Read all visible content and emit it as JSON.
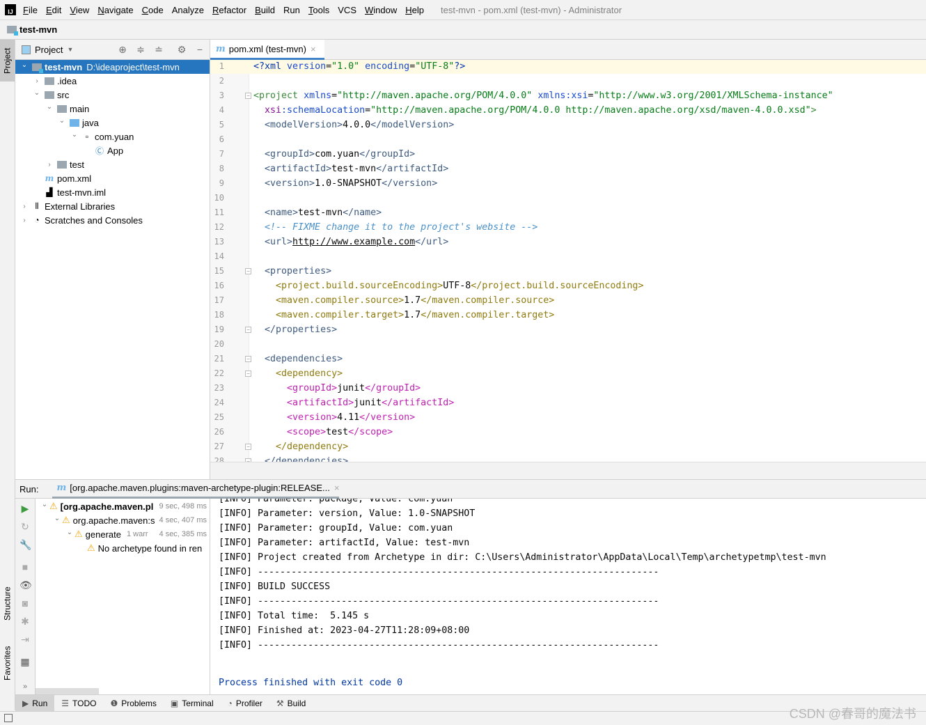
{
  "menubar": {
    "logo": "IJ",
    "items": [
      "File",
      "Edit",
      "View",
      "Navigate",
      "Code",
      "Analyze",
      "Refactor",
      "Build",
      "Run",
      "Tools",
      "VCS",
      "Window",
      "Help"
    ],
    "mnemonics": [
      0,
      0,
      0,
      0,
      0,
      -1,
      0,
      0,
      1,
      0,
      -1,
      0,
      0
    ],
    "window_title": "test-mvn - pom.xml (test-mvn) - Administrator"
  },
  "navbar": {
    "project": "test-mvn"
  },
  "left_stripe": {
    "project": "Project",
    "structure": "Structure",
    "favorites": "Favorites"
  },
  "project_panel": {
    "title": "Project",
    "tree": [
      {
        "label": "test-mvn",
        "extra": "D:\\ideaproject\\test-mvn",
        "depth": 0,
        "expanded": true,
        "icon": "module-folder",
        "selected": true,
        "bold": true
      },
      {
        "label": ".idea",
        "depth": 1,
        "expanded": false,
        "icon": "folder"
      },
      {
        "label": "src",
        "depth": 1,
        "expanded": true,
        "icon": "folder"
      },
      {
        "label": "main",
        "depth": 2,
        "expanded": true,
        "icon": "folder"
      },
      {
        "label": "java",
        "depth": 3,
        "expanded": true,
        "icon": "source-folder"
      },
      {
        "label": "com.yuan",
        "depth": 4,
        "expanded": true,
        "icon": "package"
      },
      {
        "label": "App",
        "depth": 5,
        "icon": "class"
      },
      {
        "label": "test",
        "depth": 2,
        "expanded": false,
        "icon": "folder"
      },
      {
        "label": "pom.xml",
        "depth": 1,
        "icon": "maven-file"
      },
      {
        "label": "test-mvn.iml",
        "depth": 1,
        "icon": "iml-file"
      },
      {
        "label": "External Libraries",
        "depth": 0,
        "expanded": false,
        "icon": "libraries"
      },
      {
        "label": "Scratches and Consoles",
        "depth": 0,
        "expanded": false,
        "icon": "scratches"
      }
    ]
  },
  "editor": {
    "tab_label": "pom.xml (test-mvn)",
    "current_line": 1,
    "lines": [
      [
        [
          "<?",
          "t-pi"
        ],
        [
          "xml ",
          "t-pi"
        ],
        [
          "version",
          "t-attr"
        ],
        [
          "=",
          "t-txt"
        ],
        [
          "\"1.0\"",
          "t-val"
        ],
        [
          " encoding",
          "t-attr"
        ],
        [
          "=",
          "t-txt"
        ],
        [
          "\"UTF-8\"",
          "t-val"
        ],
        [
          "?>",
          "t-pi"
        ]
      ],
      [],
      [
        [
          "<project ",
          "t-l0"
        ],
        [
          "xmlns",
          "t-attr"
        ],
        [
          "=",
          "t-txt"
        ],
        [
          "\"http://maven.apache.org/POM/4.0.0\"",
          "t-val"
        ],
        [
          " xmlns:xsi",
          "t-attr"
        ],
        [
          "=",
          "t-txt"
        ],
        [
          "\"http://www.w3.org/2001/XMLSchema-instance\"",
          "t-val"
        ]
      ],
      [
        [
          "  ",
          " "
        ],
        [
          "xsi",
          "t-ns"
        ],
        [
          ":schemaLocation",
          "t-attr"
        ],
        [
          "=",
          "t-txt"
        ],
        [
          "\"http://maven.apache.org/POM/4.0.0 http://maven.apache.org/xsd/maven-4.0.0.xsd\"",
          "t-val"
        ],
        [
          ">",
          "t-l0"
        ]
      ],
      [
        [
          "  <modelVersion>",
          "t-l1"
        ],
        [
          "4.0.0",
          "t-txt"
        ],
        [
          "</modelVersion>",
          "t-l1"
        ]
      ],
      [],
      [
        [
          "  <groupId>",
          "t-l1"
        ],
        [
          "com.yuan",
          "t-txt"
        ],
        [
          "</groupId>",
          "t-l1"
        ]
      ],
      [
        [
          "  <artifactId>",
          "t-l1"
        ],
        [
          "test-mvn",
          "t-txt"
        ],
        [
          "</artifactId>",
          "t-l1"
        ]
      ],
      [
        [
          "  <version>",
          "t-l1"
        ],
        [
          "1.0-SNAPSHOT",
          "t-txt"
        ],
        [
          "</version>",
          "t-l1"
        ]
      ],
      [],
      [
        [
          "  <name>",
          "t-l1"
        ],
        [
          "test-mvn",
          "t-txt"
        ],
        [
          "</name>",
          "t-l1"
        ]
      ],
      [
        [
          "  <!-- FIXME change it to the project's website -->",
          "t-com"
        ]
      ],
      [
        [
          "  <url>",
          "t-l1"
        ],
        [
          "http://www.example.com",
          "t-url"
        ],
        [
          "</url>",
          "t-l1"
        ]
      ],
      [],
      [
        [
          "  <properties>",
          "t-l1"
        ]
      ],
      [
        [
          "    <project.build.sourceEncoding>",
          "t-l2"
        ],
        [
          "UTF-8",
          "t-txt"
        ],
        [
          "</project.build.sourceEncoding>",
          "t-l2"
        ]
      ],
      [
        [
          "    <maven.compiler.source>",
          "t-l2"
        ],
        [
          "1.7",
          "t-txt"
        ],
        [
          "</maven.compiler.source>",
          "t-l2"
        ]
      ],
      [
        [
          "    <maven.compiler.target>",
          "t-l2"
        ],
        [
          "1.7",
          "t-txt"
        ],
        [
          "</maven.compiler.target>",
          "t-l2"
        ]
      ],
      [
        [
          "  </properties>",
          "t-l1"
        ]
      ],
      [],
      [
        [
          "  <dependencies>",
          "t-l1"
        ]
      ],
      [
        [
          "    <dependency>",
          "t-l2"
        ]
      ],
      [
        [
          "      <groupId>",
          "t-l3"
        ],
        [
          "junit",
          "t-txt"
        ],
        [
          "</groupId>",
          "t-l3"
        ]
      ],
      [
        [
          "      <artifactId>",
          "t-l3"
        ],
        [
          "junit",
          "t-txt"
        ],
        [
          "</artifactId>",
          "t-l3"
        ]
      ],
      [
        [
          "      <version>",
          "t-l3"
        ],
        [
          "4.11",
          "t-txt"
        ],
        [
          "</version>",
          "t-l3"
        ]
      ],
      [
        [
          "      <scope>",
          "t-l3"
        ],
        [
          "test",
          "t-txt"
        ],
        [
          "</scope>",
          "t-l3"
        ]
      ],
      [
        [
          "    </dependency>",
          "t-l2"
        ]
      ],
      [
        [
          "  </dependencies>",
          "t-l1"
        ]
      ]
    ],
    "fold_lines": [
      3,
      15,
      19,
      21,
      22,
      27,
      28
    ]
  },
  "run": {
    "label": "Run:",
    "tab_label": "[org.apache.maven.plugins:maven-archetype-plugin:RELEASE...",
    "tree": [
      {
        "label": "[org.apache.maven.pl",
        "time": "9 sec, 498 ms",
        "depth": 0,
        "bold": true
      },
      {
        "label": "org.apache.maven:s",
        "time": "4 sec, 407 ms",
        "depth": 1
      },
      {
        "label": "generate",
        "note": "1 warr",
        "time": "4 sec, 385 ms",
        "depth": 2
      },
      {
        "label": "No archetype found in ren",
        "depth": 3
      }
    ],
    "console": [
      "[INFO] Parameter: package, Value: com.yuan",
      "[INFO] Parameter: version, Value: 1.0-SNAPSHOT",
      "[INFO] Parameter: groupId, Value: com.yuan",
      "[INFO] Parameter: artifactId, Value: test-mvn",
      "[INFO] Project created from Archetype in dir: C:\\Users\\Administrator\\AppData\\Local\\Temp\\archetypetmp\\test-mvn",
      "[INFO] ------------------------------------------------------------------------",
      "[INFO] BUILD SUCCESS",
      "[INFO] ------------------------------------------------------------------------",
      "[INFO] Total time:  5.145 s",
      "[INFO] Finished at: 2023-04-27T11:28:09+08:00",
      "[INFO] ------------------------------------------------------------------------",
      ""
    ],
    "process_finished": "Process finished with exit code 0"
  },
  "bottom_tools": [
    {
      "label": "Run",
      "icon": "play-icon",
      "active": true
    },
    {
      "label": "TODO",
      "icon": "list-icon"
    },
    {
      "label": "Problems",
      "icon": "problems-icon"
    },
    {
      "label": "Terminal",
      "icon": "terminal-icon"
    },
    {
      "label": "Profiler",
      "icon": "profiler-icon"
    },
    {
      "label": "Build",
      "icon": "hammer-icon"
    }
  ],
  "watermark": "CSDN @春哥的魔法书",
  "colors": {
    "selection": "#2675bf",
    "accent": "#4083c9",
    "warning": "#f0a30a",
    "console_blue": "#0037a6"
  }
}
